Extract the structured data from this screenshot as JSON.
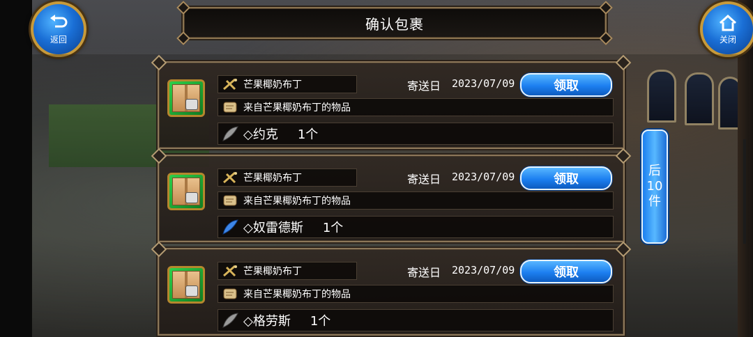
{
  "header": {
    "title": "确认包裹",
    "back_label": "返回",
    "close_label": "关闭"
  },
  "next_page": {
    "line1": "后",
    "line2": "10",
    "line3": "件"
  },
  "parcels": [
    {
      "sender": "芒果椰奶布丁",
      "date_label": "寄送日",
      "date": "2023/07/09",
      "claim_label": "领取",
      "description": "来自芒果椰奶布丁的物品",
      "item_name": "◇约克",
      "quantity": "1个",
      "item_icon": "grey-feather-icon"
    },
    {
      "sender": "芒果椰奶布丁",
      "date_label": "寄送日",
      "date": "2023/07/09",
      "claim_label": "领取",
      "description": "来自芒果椰奶布丁的物品",
      "item_name": "◇奴雷德斯",
      "quantity": "1个",
      "item_icon": "blue-feather-icon"
    },
    {
      "sender": "芒果椰奶布丁",
      "date_label": "寄送日",
      "date": "2023/07/09",
      "claim_label": "领取",
      "description": "来自芒果椰奶布丁的物品",
      "item_name": "◇格劳斯",
      "quantity": "1个",
      "item_icon": "grey-feather-icon"
    }
  ],
  "colors": {
    "accent_blue": "#1c7ff0",
    "frame_gold": "#8c7759",
    "icon_green": "#2fd04a"
  }
}
